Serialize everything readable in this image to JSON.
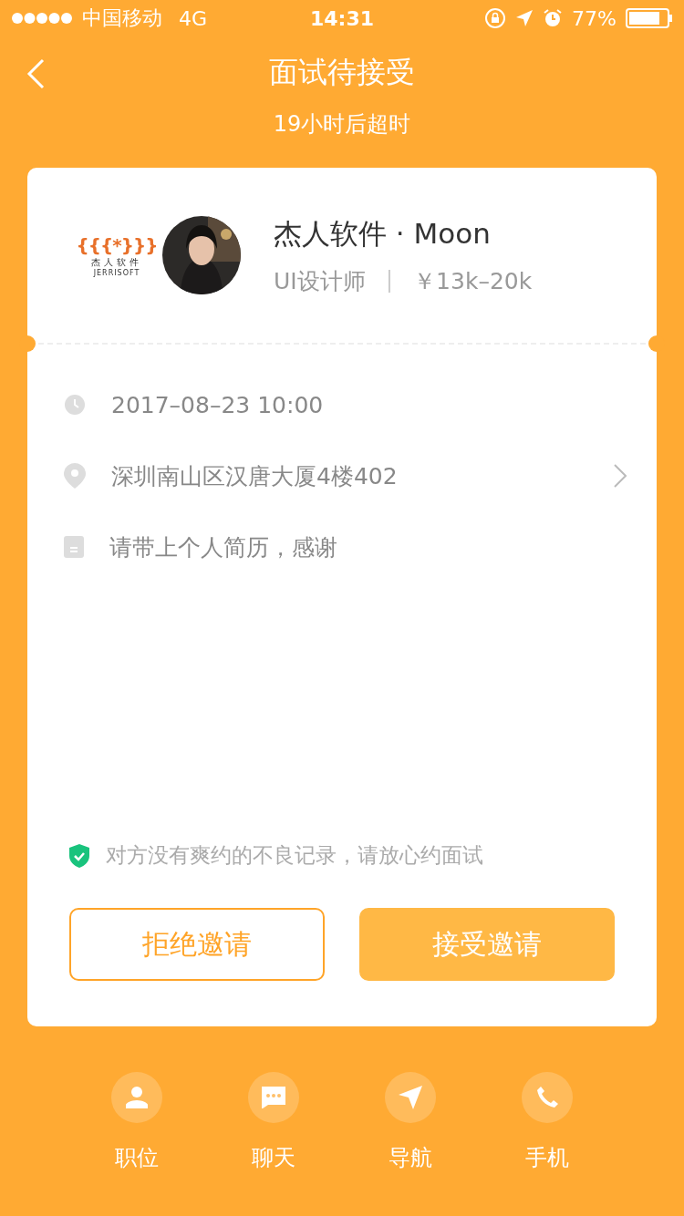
{
  "status_bar": {
    "carrier": "中国移动",
    "network": "4G",
    "time": "14:31",
    "battery": "77%"
  },
  "header": {
    "title": "面试待接受",
    "subtitle": "19小时后超时"
  },
  "company": {
    "logo_mark": "{{{*}}}",
    "logo_name": "杰人软件",
    "logo_en": "JERRISOFT",
    "name": "杰人软件 · Moon",
    "position": "UI设计师",
    "separator": "|",
    "salary": "￥13k–20k"
  },
  "details": [
    {
      "kind": "time",
      "text": "2017–08–23 10:00",
      "link": false
    },
    {
      "kind": "location",
      "text": "深圳南山区汉唐大厦4楼402",
      "link": true
    },
    {
      "kind": "note",
      "text": "请带上个人简历，感谢",
      "link": false
    }
  ],
  "notice": "对方没有爽约的不良记录，请放心约面试",
  "buttons": [
    {
      "kind": "outline",
      "label": "拒绝邀请"
    },
    {
      "kind": "solid",
      "label": "接受邀请"
    }
  ],
  "actions": [
    {
      "kind": "person",
      "label": "职位"
    },
    {
      "kind": "chat",
      "label": "聊天"
    },
    {
      "kind": "navigate",
      "label": "导航"
    },
    {
      "kind": "phone",
      "label": "手机"
    }
  ]
}
